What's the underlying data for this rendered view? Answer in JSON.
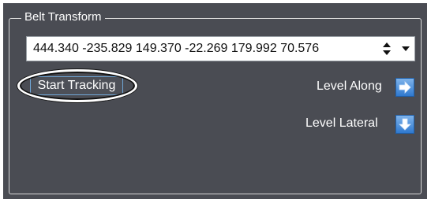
{
  "group": {
    "title": "Belt Transform"
  },
  "transform_combo": {
    "value": "444.340 -235.829 149.370 -22.269 179.992 70.576"
  },
  "buttons": {
    "start_tracking": "Start Tracking",
    "level_along": "Level Along",
    "level_lateral": "Level Lateral"
  },
  "icons": {
    "spin": "spin-updown-icon",
    "dropdown": "chevron-down-icon",
    "level_along": "arrow-right-icon",
    "level_lateral": "arrow-down-icon"
  },
  "colors": {
    "panel_bg": "#4a4c53",
    "accent_blue": "#2f79cf"
  }
}
